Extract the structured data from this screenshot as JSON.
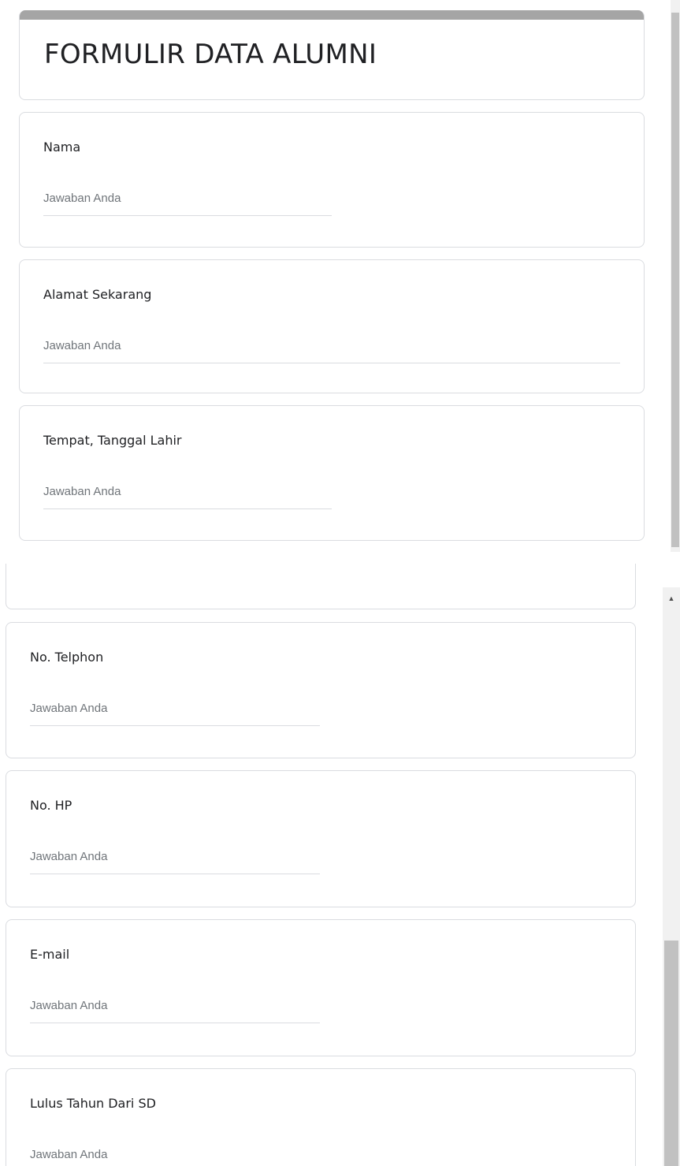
{
  "form": {
    "title": "FORMULIR DATA ALUMNI"
  },
  "questions": [
    {
      "label": "Nama",
      "placeholder": "Jawaban Anda"
    },
    {
      "label": "Alamat Sekarang",
      "placeholder": "Jawaban Anda"
    },
    {
      "label": "Tempat, Tanggal Lahir",
      "placeholder": "Jawaban Anda"
    },
    {
      "label": "No. Telphon",
      "placeholder": "Jawaban Anda"
    },
    {
      "label": "No. HP",
      "placeholder": "Jawaban Anda"
    },
    {
      "label": "E-mail",
      "placeholder": "Jawaban Anda"
    },
    {
      "label": "Lulus Tahun Dari SD",
      "placeholder": "Jawaban Anda"
    }
  ],
  "icons": {
    "scroll_up": "triangle-up"
  },
  "colors": {
    "header_bar": "#a5a5a5",
    "card_border": "#dadce0",
    "placeholder": "#70757a"
  }
}
